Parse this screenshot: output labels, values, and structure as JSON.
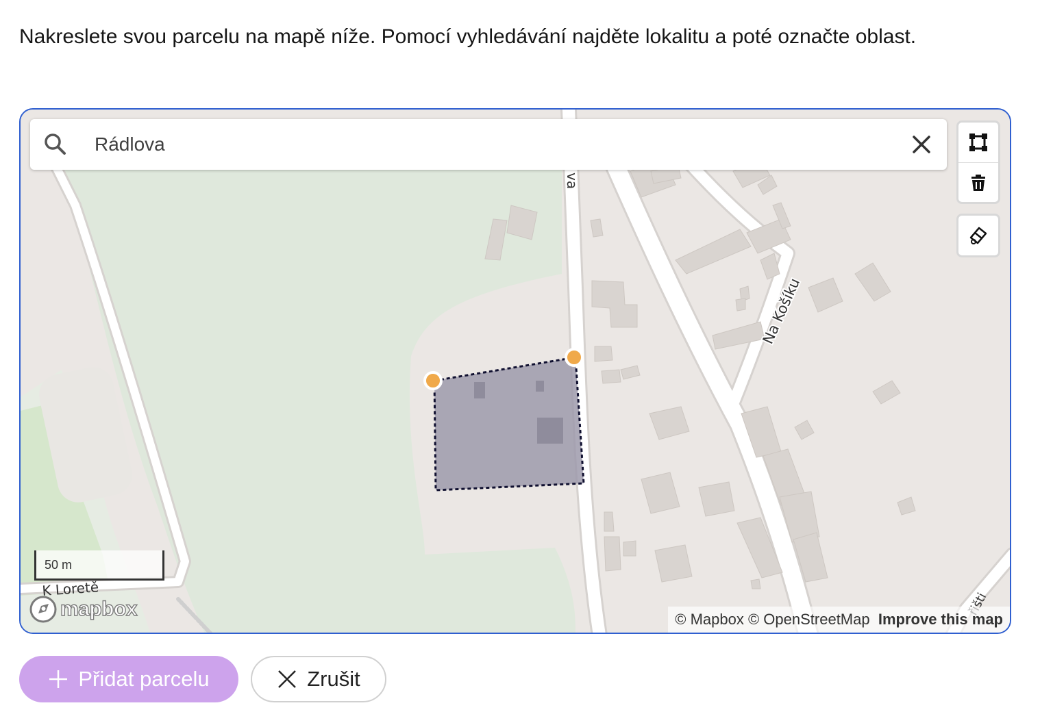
{
  "intro_text": "Nakreslete svou parcelu na mapě níže. Pomocí vyhledávání najděte lokalitu a poté označte oblast.",
  "map": {
    "search": {
      "value": "Rádlova",
      "icon": "search-icon",
      "clear_icon": "close-icon"
    },
    "controls": {
      "draw_polygon_icon": "polygon-draw-icon",
      "trash_icon": "trash-icon",
      "eraser_icon": "eraser-icon"
    },
    "street_labels": {
      "radlova_fragment": "va",
      "na_kosiku": "Na Košíku",
      "k_lorete": "K Loretě",
      "bottom_right_fragment": "řišti"
    },
    "scale_label": "50 m",
    "logo_text": "mapbox",
    "attribution": {
      "mapbox": "© Mapbox",
      "osm": "© OpenStreetMap",
      "improve": "Improve this map"
    },
    "colors": {
      "frame_border": "#2f5fd0",
      "polygon_fill": "#9d9aab",
      "vertex": "#f0a94a",
      "park": "#dfe8dc",
      "road": "#ffffff",
      "land": "#ebe7e4"
    }
  },
  "actions": {
    "add_parcel_label": "Přidat parcelu",
    "add_parcel_icon": "plus-icon",
    "cancel_label": "Zrušit",
    "cancel_icon": "close-icon",
    "primary_color": "#cda3ec"
  }
}
